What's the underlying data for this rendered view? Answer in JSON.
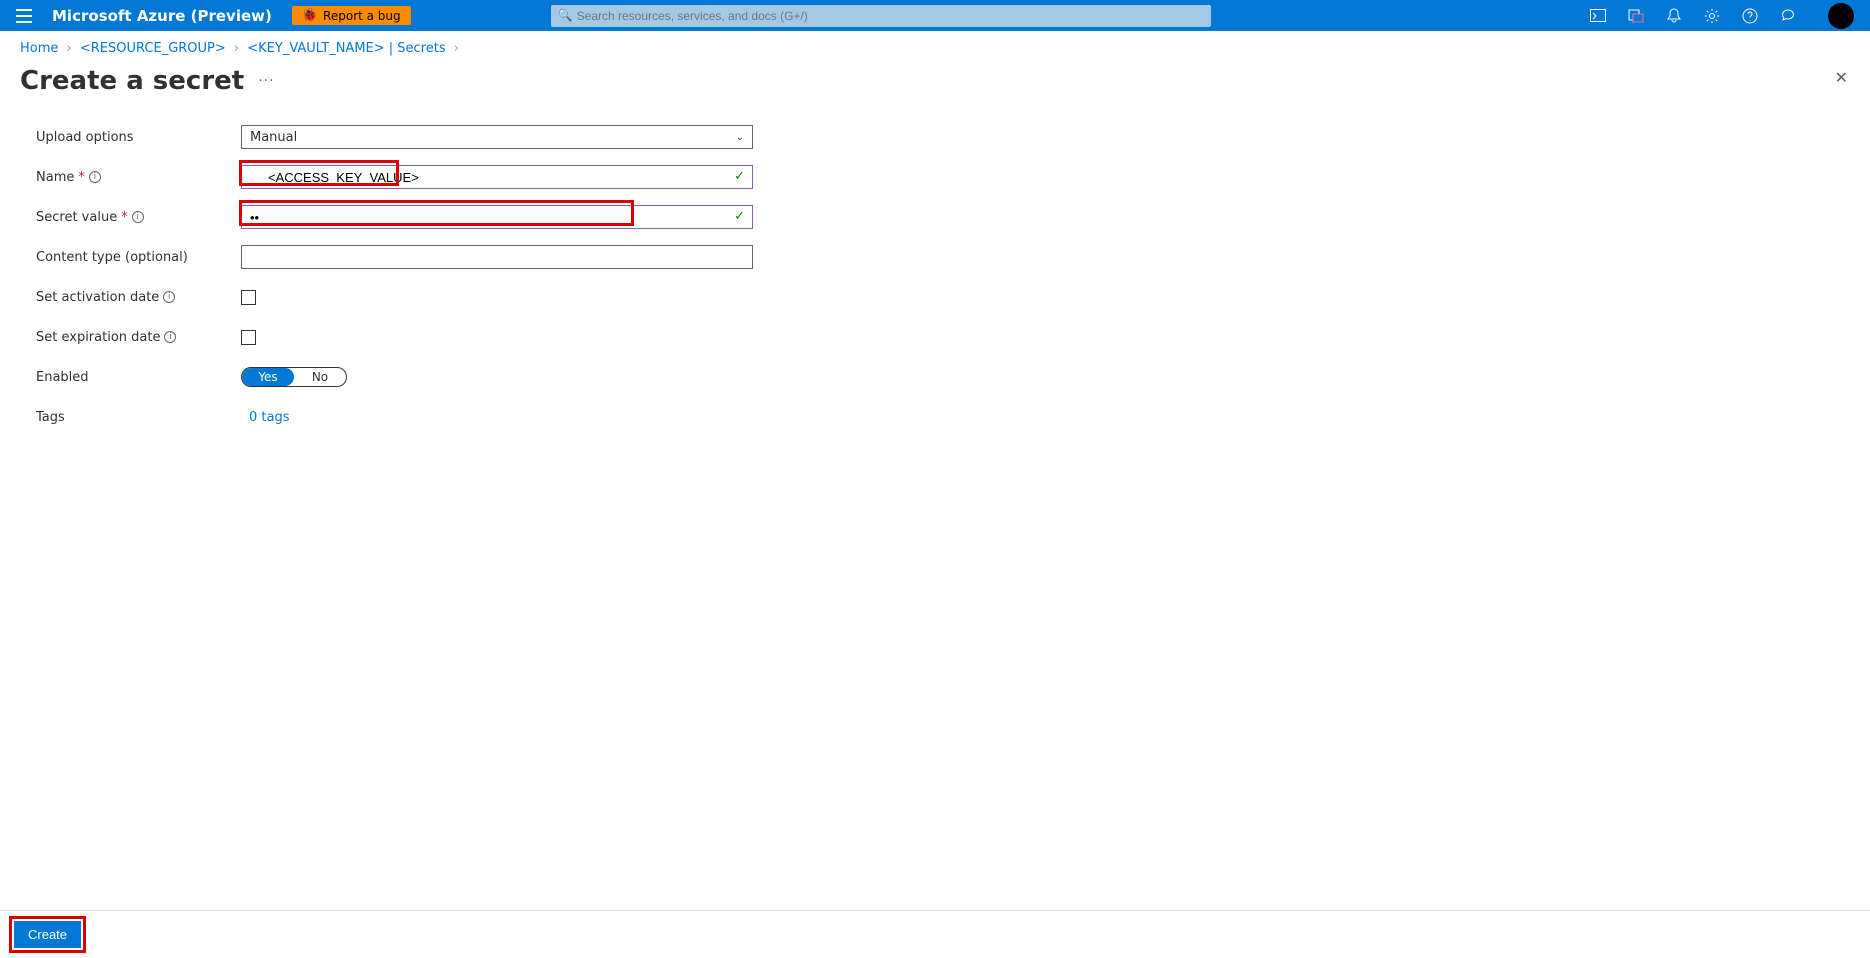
{
  "header": {
    "brand": "Microsoft Azure (Preview)",
    "report_bug": "Report a bug",
    "search_placeholder": "Search resources, services, and docs (G+/)"
  },
  "breadcrumb": {
    "home": "Home",
    "rg": "<RESOURCE_GROUP>",
    "kv": "<KEY_VAULT_NAME> | Secrets"
  },
  "page": {
    "title": "Create a secret"
  },
  "form": {
    "upload_options": {
      "label": "Upload options",
      "value": "Manual"
    },
    "name": {
      "label": "Name",
      "value": "<ACCESS_KEY_VALUE>"
    },
    "secret_value": {
      "label": "Secret value",
      "value": "••"
    },
    "content_type": {
      "label": "Content type (optional)",
      "value": ""
    },
    "activation": {
      "label": "Set activation date"
    },
    "expiration": {
      "label": "Set expiration date"
    },
    "enabled": {
      "label": "Enabled",
      "yes": "Yes",
      "no": "No"
    },
    "tags": {
      "label": "Tags",
      "link": "0 tags"
    }
  },
  "footer": {
    "create": "Create"
  }
}
